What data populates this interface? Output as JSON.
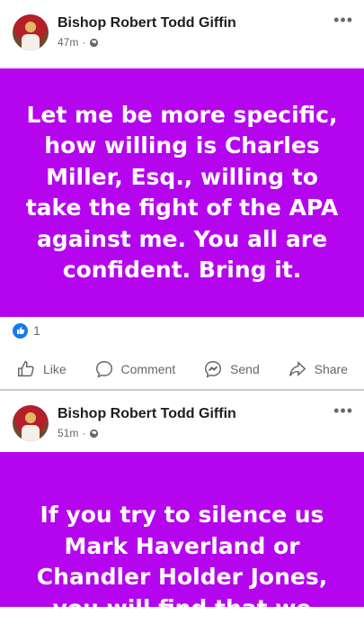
{
  "posts": [
    {
      "author": "Bishop Robert Todd Giffin",
      "time": "47m",
      "text": "Let me be more specific, how willing is Charles Miller, Esq., willing to take the fight of the APA against me. You all are confident. Bring it.",
      "reaction_count": "1",
      "actions": {
        "like": "Like",
        "comment": "Comment",
        "send": "Send",
        "share": "Share"
      }
    },
    {
      "author": "Bishop Robert Todd Giffin",
      "time": "51m",
      "text": "If you try to silence us Mark Haverland or Chandler Holder Jones, you will find that we"
    }
  ],
  "colors": {
    "post_background": "#b505ee",
    "like_blue": "#1877f2"
  },
  "icons": [
    "avatar",
    "globe-icon",
    "more-icon",
    "like-icon",
    "comment-icon",
    "send-icon",
    "share-icon"
  ]
}
